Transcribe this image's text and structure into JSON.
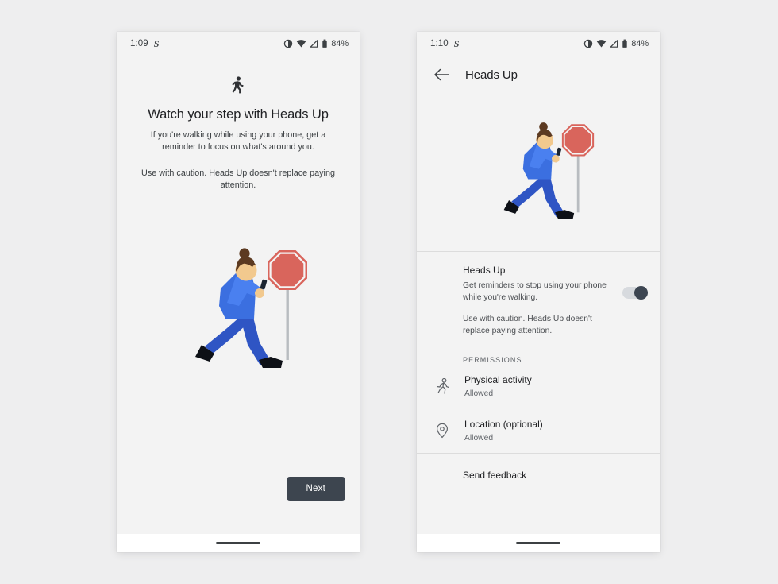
{
  "colors": {
    "page_background": "#eeeeef",
    "screen_background": "#f3f3f3",
    "accent_button": "#3d454f",
    "toggle_knob": "#3d4652",
    "jacket_blue": "#3b6fe0",
    "sleeve_blue": "#4a80f0",
    "pants_blue": "#2f55c4",
    "skin": "#f2c98e",
    "hair": "#5c3a21",
    "shoe": "#0d1016",
    "sign_red": "#d9655c",
    "sign_pole": "#b8bcc0"
  },
  "left_screen": {
    "status_bar": {
      "time": "1:09",
      "carrier_glyph": "S",
      "battery_percent": "84%",
      "icons": [
        "dnd-icon",
        "wifi-icon",
        "signal-icon",
        "battery-icon"
      ]
    },
    "top_icon": "walking-person-icon",
    "title": "Watch your step with Heads Up",
    "description": "If you're walking while using your phone, get a reminder to focus on what's around you.",
    "caution": "Use with caution. Heads Up doesn't replace paying attention.",
    "next_button": "Next",
    "illustration": "person-running-with-phone-and-stop-sign"
  },
  "right_screen": {
    "status_bar": {
      "time": "1:10",
      "carrier_glyph": "S",
      "battery_percent": "84%",
      "icons": [
        "dnd-icon",
        "wifi-icon",
        "signal-icon",
        "battery-icon"
      ]
    },
    "appbar": {
      "back": "back-arrow-icon",
      "title": "Heads Up"
    },
    "illustration": "person-running-with-phone-and-stop-sign",
    "master": {
      "title": "Heads Up",
      "description": "Get reminders to stop using your phone while you're walking.",
      "caution": "Use with caution. Heads Up doesn't replace paying attention.",
      "toggle_state": "on"
    },
    "permissions_label": "PERMISSIONS",
    "permissions": [
      {
        "icon": "running-person-icon",
        "title": "Physical activity",
        "status": "Allowed"
      },
      {
        "icon": "location-pin-icon",
        "title": "Location (optional)",
        "status": "Allowed"
      }
    ],
    "feedback": "Send feedback"
  }
}
